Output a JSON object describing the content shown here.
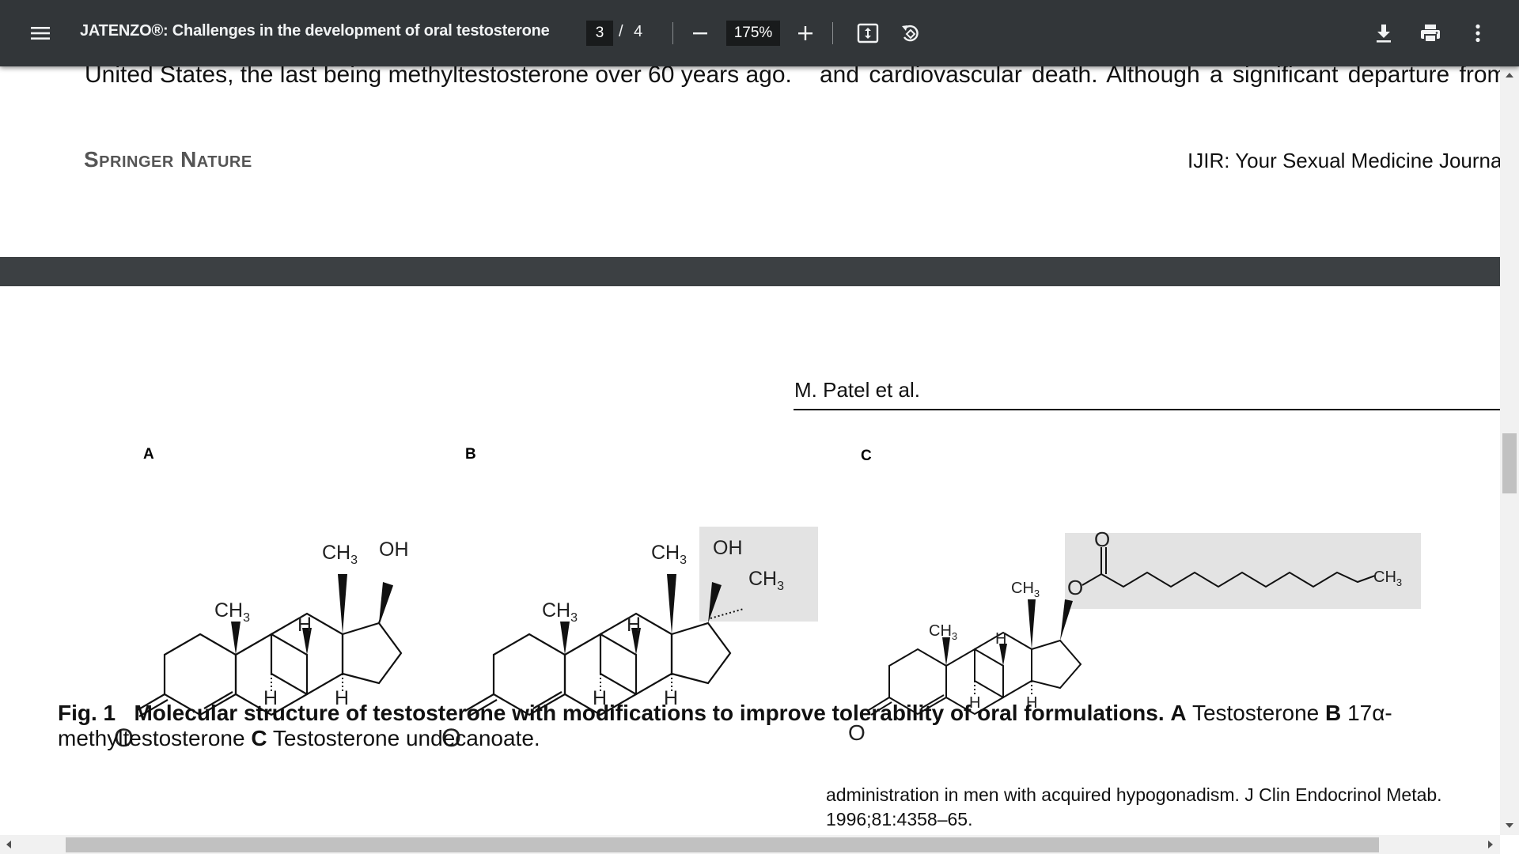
{
  "toolbar": {
    "title": "JATENZO®: Challenges in the development of oral testosterone",
    "page_current": "3",
    "page_separator": "/",
    "page_total": "4",
    "zoom": "175%",
    "icons": [
      "menu-icon",
      "zoom-out-icon",
      "zoom-in-icon",
      "fit-page-icon",
      "rotate-icon",
      "download-icon",
      "print-icon",
      "more-vert-icon"
    ]
  },
  "page": {
    "topline_left": "United States, the last being methyltestosterone over 60 years ago.",
    "topline_right": "and cardiovascular death. Although a significant departure from",
    "publisher": "Springer Nature",
    "journal": "IJIR: Your Sexual Medicine Journal",
    "author": "M. Patel et al."
  },
  "figure": {
    "panels": [
      "A",
      "B",
      "C"
    ],
    "labels": {
      "ch3": "CH",
      "sub3": "3",
      "oh": "OH",
      "h": "H",
      "o": "O"
    },
    "caption": {
      "fig": "Fig. 1",
      "bold_text": "Molecular structure of testosterone with modifications to improve tolerability of oral formulations.",
      "a_key": "A",
      "a_text": "Testosterone",
      "b_key": "B",
      "b_text": "17α-methyltestosterone",
      "c_key": "C",
      "c_text": "Testosterone undecanoate."
    }
  },
  "reference": "administration in men with acquired hypogonadism. J Clin Endocrinol Metab. 1996;81:4358–65."
}
